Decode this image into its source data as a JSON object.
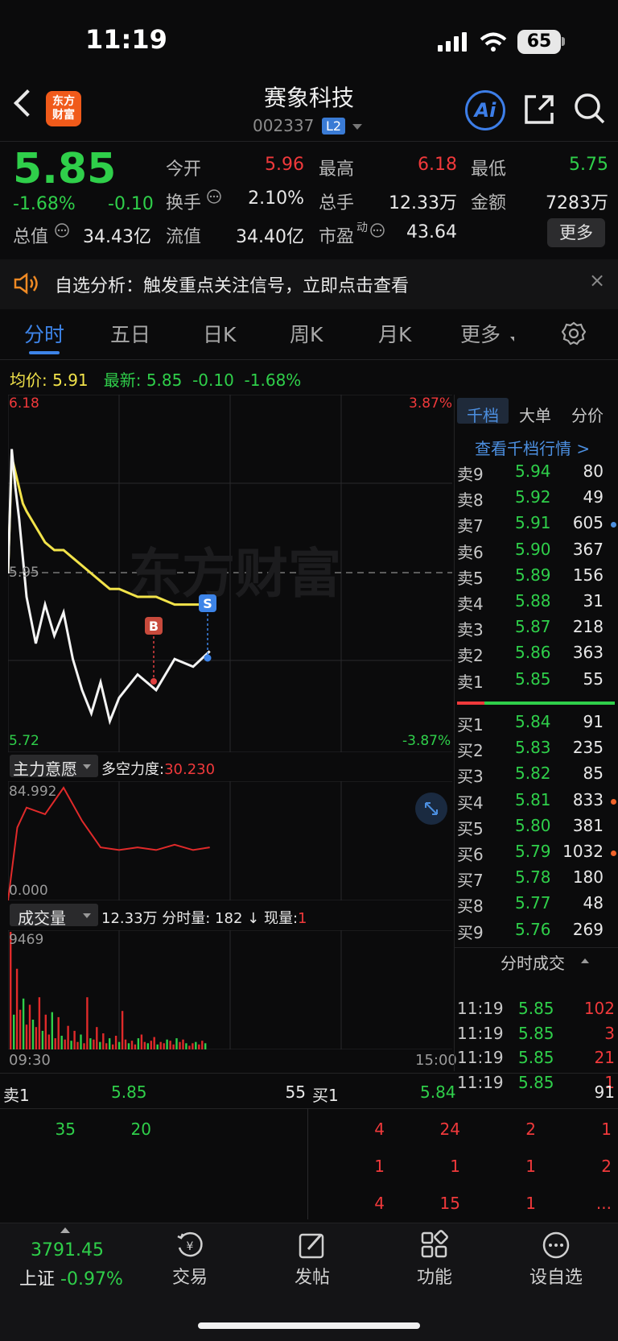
{
  "status_bar": {
    "time": "11:19",
    "battery": "65"
  },
  "header": {
    "logo_line1": "东方",
    "logo_line2": "财富",
    "stock_name": "赛象科技",
    "stock_code": "002337",
    "level_badge": "L2",
    "ai_label": "Ai"
  },
  "quote": {
    "price": "5.85",
    "change_pct": "-1.68%",
    "change": "-0.10",
    "open_label": "今开",
    "open": "5.96",
    "high_label": "最高",
    "high": "6.18",
    "low_label": "最低",
    "low": "5.75",
    "turnover_label": "换手",
    "turnover": "2.10%",
    "volume_label": "总手",
    "volume": "12.33万",
    "amount_label": "金额",
    "amount": "7283万",
    "mktcap_label": "总值",
    "mktcap": "34.43亿",
    "float_label": "流值",
    "float": "34.40亿",
    "pe_label": "市盈",
    "pe_sup": "动",
    "pe": "43.64",
    "more_label": "更多"
  },
  "signal": {
    "text": "自选分析：触发重点关注信号，立即点击查看",
    "close": "×"
  },
  "tabs": [
    "分时",
    "五日",
    "日K",
    "周K",
    "月K",
    "更多"
  ],
  "intraday": {
    "avg_label": "均价:",
    "avg_value": "5.91",
    "latest_label": "最新:",
    "latest_value": "5.85",
    "latest_change": "-0.10",
    "latest_pct": "-1.68%",
    "y_max": "6.18",
    "y_max_pct": "3.87%",
    "y_mid": "5.95",
    "y_min": "5.72",
    "y_min_pct": "-3.87%",
    "watermark": "东方财富",
    "marker_b": "B",
    "marker_s": "S"
  },
  "chart_data": [
    {
      "type": "line",
      "title": "",
      "ylim": [
        5.72,
        6.18
      ],
      "x": [
        "09:30",
        "09:32",
        "09:34",
        "09:36",
        "09:38",
        "09:40",
        "09:45",
        "09:50",
        "09:55",
        "10:00",
        "10:05",
        "10:10",
        "10:15",
        "10:20",
        "10:25",
        "10:30",
        "10:40",
        "10:50",
        "11:00",
        "11:10",
        "11:19"
      ],
      "series": [
        {
          "name": "最新",
          "values": [
            5.95,
            6.11,
            6.06,
            6.02,
            5.97,
            5.92,
            5.86,
            5.91,
            5.87,
            5.9,
            5.84,
            5.8,
            5.77,
            5.81,
            5.76,
            5.79,
            5.82,
            5.8,
            5.84,
            5.83,
            5.85
          ]
        },
        {
          "name": "均价",
          "values": [
            5.95,
            6.1,
            6.08,
            6.06,
            6.04,
            6.03,
            6.01,
            5.99,
            5.98,
            5.98,
            5.97,
            5.96,
            5.95,
            5.94,
            5.93,
            5.93,
            5.92,
            5.92,
            5.91,
            5.91,
            5.91
          ]
        }
      ]
    },
    {
      "type": "line",
      "title": "主力意愿",
      "ylim": [
        0,
        84.992
      ],
      "x": [
        "09:30",
        "09:35",
        "09:40",
        "09:50",
        "10:00",
        "10:10",
        "10:20",
        "10:30",
        "10:40",
        "10:50",
        "11:00",
        "11:10",
        "11:19"
      ],
      "series": [
        {
          "name": "多空力度",
          "values": [
            0,
            55,
            70,
            65,
            84.992,
            60,
            40,
            38,
            40,
            38,
            42,
            38,
            40
          ]
        }
      ]
    },
    {
      "type": "bar",
      "title": "成交量",
      "ylim": [
        0,
        9469
      ],
      "x_start": "09:30",
      "x_end": "15:00",
      "values": [
        9469,
        2800,
        6500,
        3200,
        4100,
        2000,
        3600,
        2400,
        1800,
        4200,
        1500,
        2800,
        1200,
        3000,
        900,
        2600,
        1100,
        800,
        1900,
        700,
        1500,
        600,
        1200,
        500,
        4200,
        900,
        800,
        1800,
        600,
        1300,
        500,
        900,
        400,
        1100,
        600,
        3100,
        800,
        500,
        700,
        400,
        900,
        1200,
        600,
        500,
        700,
        1000,
        400,
        600,
        500,
        800,
        700,
        400,
        900,
        600,
        800,
        500,
        300,
        500,
        600,
        400,
        700,
        500
      ]
    }
  ],
  "zhuli": {
    "label": "主力意愿",
    "force_label": "多空力度:",
    "force_value": "30.230",
    "y_max": "84.992",
    "y_min": "0.000"
  },
  "volume": {
    "label": "成交量",
    "summary": "12.33万 分时量: 182",
    "arrow": "↓",
    "now_label": "现量:",
    "now_value": "1",
    "y_max": "9469",
    "t_start": "09:30",
    "t_end": "15:00"
  },
  "right_panel": {
    "tabs": [
      "千档",
      "大单",
      "分价"
    ],
    "link": "查看千档行情 >",
    "asks": [
      {
        "label": "卖9",
        "price": "5.94",
        "vol": "80",
        "dot": ""
      },
      {
        "label": "卖8",
        "price": "5.92",
        "vol": "49",
        "dot": ""
      },
      {
        "label": "卖7",
        "price": "5.91",
        "vol": "605",
        "dot": "#4c8fe0"
      },
      {
        "label": "卖6",
        "price": "5.90",
        "vol": "367",
        "dot": ""
      },
      {
        "label": "卖5",
        "price": "5.89",
        "vol": "156",
        "dot": ""
      },
      {
        "label": "卖4",
        "price": "5.88",
        "vol": "31",
        "dot": ""
      },
      {
        "label": "卖3",
        "price": "5.87",
        "vol": "218",
        "dot": ""
      },
      {
        "label": "卖2",
        "price": "5.86",
        "vol": "363",
        "dot": ""
      },
      {
        "label": "卖1",
        "price": "5.85",
        "vol": "55",
        "dot": ""
      }
    ],
    "bids": [
      {
        "label": "买1",
        "price": "5.84",
        "vol": "91",
        "dot": ""
      },
      {
        "label": "买2",
        "price": "5.83",
        "vol": "235",
        "dot": ""
      },
      {
        "label": "买3",
        "price": "5.82",
        "vol": "85",
        "dot": ""
      },
      {
        "label": "买4",
        "price": "5.81",
        "vol": "833",
        "dot": "#f0622a"
      },
      {
        "label": "买5",
        "price": "5.80",
        "vol": "381",
        "dot": ""
      },
      {
        "label": "买6",
        "price": "5.79",
        "vol": "1032",
        "dot": "#f0622a"
      },
      {
        "label": "买7",
        "price": "5.78",
        "vol": "180",
        "dot": ""
      },
      {
        "label": "买8",
        "price": "5.77",
        "vol": "48",
        "dot": ""
      },
      {
        "label": "买9",
        "price": "5.76",
        "vol": "269",
        "dot": ""
      }
    ],
    "trades_title": "分时成交",
    "trades": [
      {
        "time": "11:19",
        "price": "5.85",
        "vol": "102"
      },
      {
        "time": "11:19",
        "price": "5.85",
        "vol": "3"
      },
      {
        "time": "11:19",
        "price": "5.85",
        "vol": "21"
      },
      {
        "time": "11:19",
        "price": "5.85",
        "vol": "1"
      }
    ]
  },
  "queue": {
    "ask_label": "卖1",
    "ask_price": "5.85",
    "ask_vol": "55",
    "bid_label": "买1",
    "bid_price": "5.84",
    "bid_vol": "91",
    "ask_orders": [
      "35",
      "20"
    ],
    "bid_rows": [
      [
        "4",
        "24",
        "2",
        "1"
      ],
      [
        "1",
        "1",
        "1",
        "2"
      ],
      [
        "4",
        "15",
        "1",
        "..."
      ]
    ]
  },
  "bottom_nav": {
    "index_value": "3791.45",
    "index_name": "上证",
    "index_pct": "-0.97%",
    "items": [
      "交易",
      "发帖",
      "功能",
      "设自选"
    ]
  },
  "colors": {
    "up": "#f0393b",
    "down": "#2fcf4a",
    "accent": "#3d84e8",
    "avg_line": "#f2e34a"
  }
}
